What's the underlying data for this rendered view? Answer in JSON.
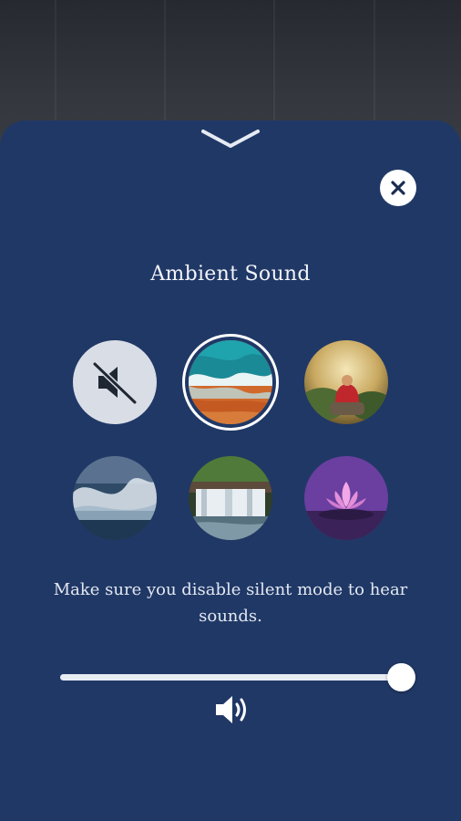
{
  "sheet": {
    "title": "Ambient Sound",
    "note": "Make sure you disable silent mode to hear sounds."
  },
  "sounds": [
    {
      "name": "mute",
      "icon": "speaker-muted-icon",
      "selected": false
    },
    {
      "name": "ocean waves",
      "selected": true
    },
    {
      "name": "meditating monk",
      "selected": false
    },
    {
      "name": "storm waves",
      "selected": false
    },
    {
      "name": "waterfall",
      "selected": false
    },
    {
      "name": "lotus flower",
      "selected": false
    }
  ],
  "volume": {
    "level": 1.0,
    "icon": "speaker-volume-icon"
  },
  "colors": {
    "sheet": "#203866",
    "accent": "#ffffff"
  }
}
